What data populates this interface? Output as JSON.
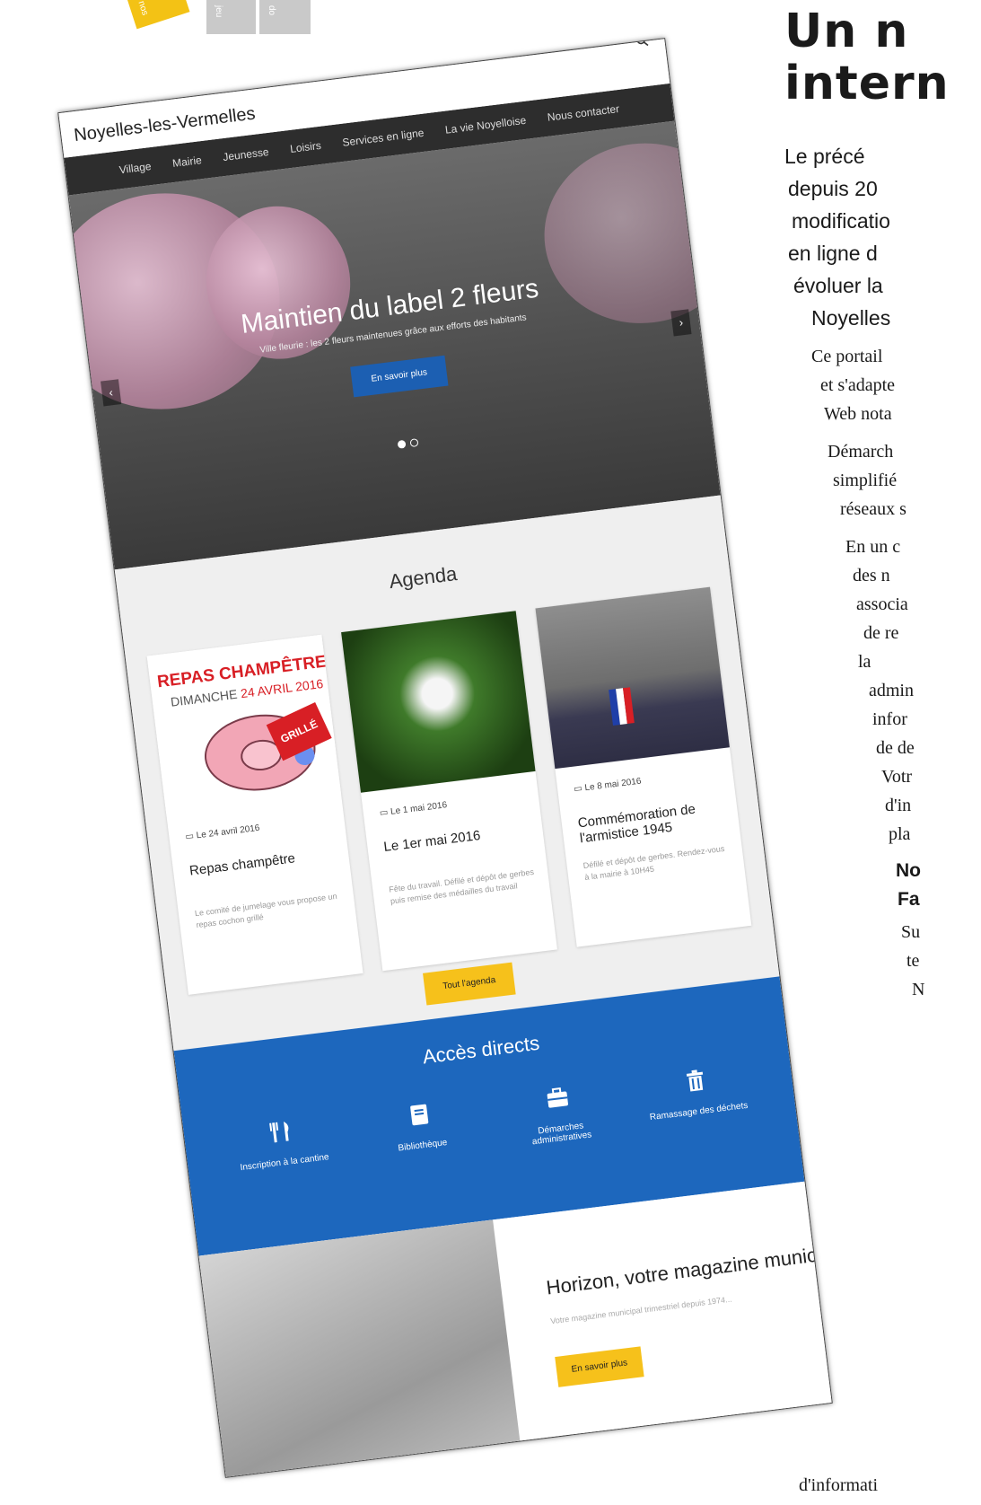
{
  "tabs": [
    "nos",
    "jeu",
    "do"
  ],
  "site": {
    "logo": "Noyelles-les-Vermelles",
    "nav": [
      "Village",
      "Mairie",
      "Jeunesse",
      "Loisirs",
      "Services en ligne",
      "La vie Noyelloise",
      "Nous contacter"
    ],
    "hero": {
      "title": "Maintien du label 2 fleurs",
      "subtitle": "Ville fleurie : les 2 fleurs maintenues grâce aux efforts des habitants",
      "button": "En savoir plus"
    },
    "agenda": {
      "title": "Agenda",
      "cards": [
        {
          "date": "Le 24 avril 2016",
          "title": "Repas champêtre",
          "desc": "Le comité de jumelage vous propose un repas cochon grillé"
        },
        {
          "date": "Le 1 mai 2016",
          "title": "Le 1er mai 2016",
          "desc": "Fête du travail. Défilé et dépôt de gerbes puis remise des médailles du travail"
        },
        {
          "date": "Le 8 mai 2016",
          "title": "Commémoration de l'armistice 1945",
          "desc": "Défilé et dépôt de gerbes. Rendez-vous à la mairie à 10H45"
        }
      ],
      "button": "Tout l'agenda",
      "repas_image": {
        "line1": "REPAS CHAMPÊTRE",
        "line2a": "DIMANCHE ",
        "line2b": "24 AVRIL 2016",
        "stamp": "GRILLÉ"
      }
    },
    "acces": {
      "title": "Accès directs",
      "items": [
        {
          "label": "Inscription à la cantine",
          "icon": "cutlery-icon"
        },
        {
          "label": "Bibliothèque",
          "icon": "book-icon"
        },
        {
          "label": "Démarches administratives",
          "icon": "briefcase-icon"
        },
        {
          "label": "Ramassage des déchets",
          "icon": "trash-icon"
        }
      ]
    },
    "magazine": {
      "title": "Horizon, votre magazine municipal",
      "subtitle": "Votre magazine municipal trimestriel depuis 1974...",
      "button": "En savoir plus"
    }
  },
  "article": {
    "title_line1": "Un n",
    "title_line2": "intern",
    "lead": [
      "Le précé",
      "depuis 20",
      "modificatio",
      "en ligne d",
      "évoluer la",
      "Noyelles"
    ],
    "para1": [
      "Ce portail",
      "et s'adapte",
      "Web nota"
    ],
    "para2": [
      "Démarch",
      "simplifié",
      "réseaux s"
    ],
    "para3": [
      "En un c",
      "des    n",
      "associa",
      "de   re",
      "la",
      "admin",
      "infor",
      "de de",
      "Votr",
      "d'in",
      "pla"
    ],
    "bold": [
      "No",
      "Fa"
    ],
    "para4": [
      "Su",
      "te",
      "N"
    ],
    "footer": "d'informati"
  },
  "colors": {
    "brand_blue": "#1d67bd",
    "accent_yellow": "#f6c11b",
    "nav_dark": "#2d2d2d",
    "repas_red": "#d81f25"
  }
}
